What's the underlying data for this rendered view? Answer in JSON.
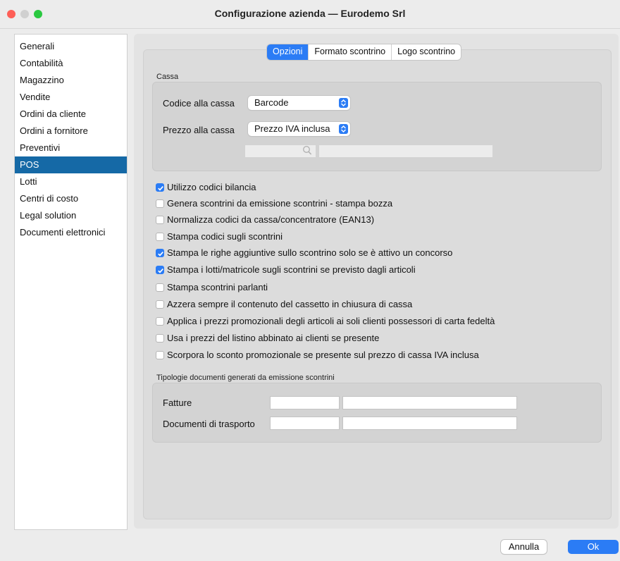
{
  "window": {
    "title": "Configurazione azienda — Eurodemo Srl"
  },
  "sidebar": {
    "items": [
      {
        "label": "Generali"
      },
      {
        "label": "Contabilità"
      },
      {
        "label": "Magazzino"
      },
      {
        "label": "Vendite"
      },
      {
        "label": "Ordini da cliente"
      },
      {
        "label": "Ordini a fornitore"
      },
      {
        "label": "Preventivi"
      },
      {
        "label": "POS",
        "selected": true
      },
      {
        "label": "Lotti"
      },
      {
        "label": "Centri di costo"
      },
      {
        "label": "Legal solution"
      },
      {
        "label": "Documenti elettronici"
      }
    ]
  },
  "tabs": [
    {
      "label": "Opzioni",
      "active": true
    },
    {
      "label": "Formato scontrino"
    },
    {
      "label": "Logo scontrino"
    }
  ],
  "cassa": {
    "group_label": "Cassa",
    "codice_label": "Codice alla cassa",
    "codice_value": "Barcode",
    "prezzo_label": "Prezzo alla cassa",
    "prezzo_value": "Prezzo IVA inclusa",
    "lookup_code": "",
    "lookup_desc": ""
  },
  "options": [
    {
      "label": "Utilizzo codici bilancia",
      "checked": true
    },
    {
      "label": "Genera scontrini da emissione scontrini - stampa bozza",
      "checked": false
    },
    {
      "label": "Normalizza codici da cassa/concentratore (EAN13)",
      "checked": false
    },
    {
      "label": "Stampa codici sugli scontrini",
      "checked": false
    },
    {
      "label": "Stampa le righe aggiuntive sullo scontrino solo se è attivo un concorso",
      "checked": true
    },
    {
      "label": "Stampa i lotti/matricole sugli scontrini se previsto dagli articoli",
      "checked": true
    },
    {
      "label": "Stampa scontrini parlanti",
      "checked": false
    },
    {
      "label": "Azzera sempre il contenuto del cassetto in chiusura di cassa",
      "checked": false
    },
    {
      "label": "Applica i prezzi promozionali degli articoli ai soli clienti possessori di carta fedeltà",
      "checked": false
    },
    {
      "label": "Usa i prezzi del listino abbinato ai clienti se presente",
      "checked": false
    },
    {
      "label": "Scorpora lo sconto promozionale se presente sul prezzo di cassa IVA inclusa",
      "checked": false
    }
  ],
  "tipologie": {
    "group_label": "Tipologie documenti generati da emissione scontrini",
    "fatture_label": "Fatture",
    "fatture_code": "",
    "fatture_desc": "",
    "ddt_label": "Documenti di trasporto",
    "ddt_code": "",
    "ddt_desc": ""
  },
  "buttons": {
    "cancel": "Annulla",
    "ok": "Ok"
  },
  "colors": {
    "accent": "#2b7cf5",
    "sidebar_selected": "#1569a6"
  },
  "icons": [
    "search-icon",
    "checkmark-icon",
    "chevron-updown-icon"
  ]
}
